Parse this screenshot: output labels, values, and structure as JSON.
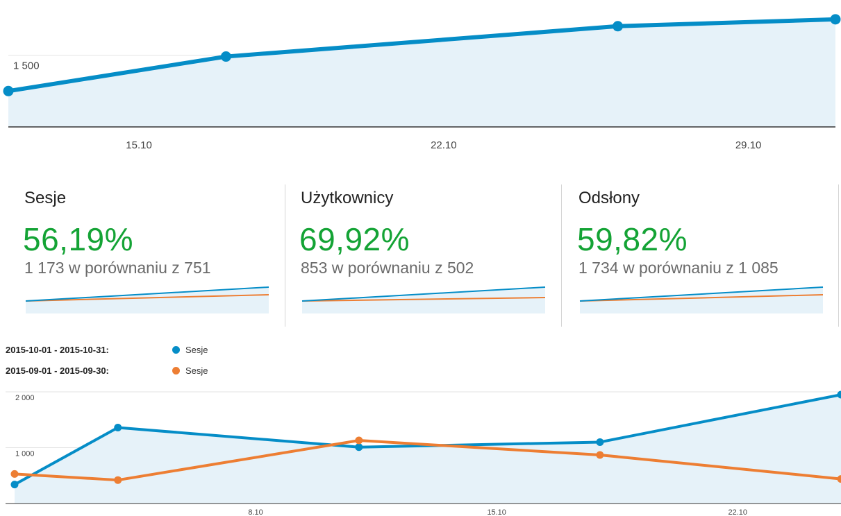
{
  "colors": {
    "primary": "#058dc7",
    "compare": "#ed7e33",
    "fill": "#e6f2f9",
    "positive": "#14a335"
  },
  "metrics": [
    {
      "title": "Sesje",
      "percent": "56,19%",
      "comparison": "1 173 w porównaniu z 751",
      "trend_current": [
        0,
        1
      ],
      "trend_previous": [
        0,
        0.45
      ]
    },
    {
      "title": "Użytkownicy",
      "percent": "69,92%",
      "comparison": "853 w porównaniu z 502",
      "trend_current": [
        0,
        1
      ],
      "trend_previous": [
        0,
        0.25
      ]
    },
    {
      "title": "Odsłony",
      "percent": "59,82%",
      "comparison": "1 734 w porównaniu z 1 085",
      "trend_current": [
        0,
        1
      ],
      "trend_previous": [
        0,
        0.45
      ]
    }
  ],
  "legend": [
    {
      "range": "2015-10-01 - 2015-10-31:",
      "series": "Sesje",
      "color": "#058dc7"
    },
    {
      "range": "2015-09-01 - 2015-09-30:",
      "series": "Sesje",
      "color": "#ed7e33"
    }
  ],
  "chart_data": [
    {
      "type": "area",
      "x": [
        "2015-10-12",
        "2015-10-17",
        "2015-10-26",
        "2015-10-31"
      ],
      "series": [
        {
          "values": [
            1240,
            1490,
            1710,
            1760
          ]
        }
      ],
      "yticks": [
        1500
      ],
      "ytick_labels": [
        "1 500"
      ],
      "xticks": [
        "2015-10-15",
        "2015-10-22",
        "2015-10-29"
      ],
      "xtick_labels": [
        "15.10",
        "22.10",
        "29.10"
      ],
      "xlim": [
        "2015-10-12",
        "2015-10-31"
      ],
      "ylim": [
        980,
        1900
      ],
      "grid": true
    },
    {
      "type": "line",
      "x": [
        "2015-10-01",
        "2015-10-04",
        "2015-10-11",
        "2015-10-18",
        "2015-10-25"
      ],
      "series": [
        {
          "name": "Sesje",
          "range": "2015-10-01 - 2015-10-31",
          "color": "#058dc7",
          "values": [
            340,
            1360,
            1010,
            1100,
            1950
          ]
        },
        {
          "name": "Sesje",
          "range": "2015-09-01 - 2015-09-30",
          "color": "#ed7e33",
          "values": [
            530,
            420,
            1130,
            870,
            440
          ]
        }
      ],
      "yticks": [
        1000,
        2000
      ],
      "ytick_labels": [
        "1 000",
        "2 000"
      ],
      "xticks": [
        "2015-10-08",
        "2015-10-15",
        "2015-10-22"
      ],
      "xtick_labels": [
        "8.10",
        "15.10",
        "22.10"
      ],
      "xlim": [
        "2015-10-01",
        "2015-10-25"
      ],
      "ylim": [
        0,
        2000
      ],
      "grid": true
    }
  ]
}
